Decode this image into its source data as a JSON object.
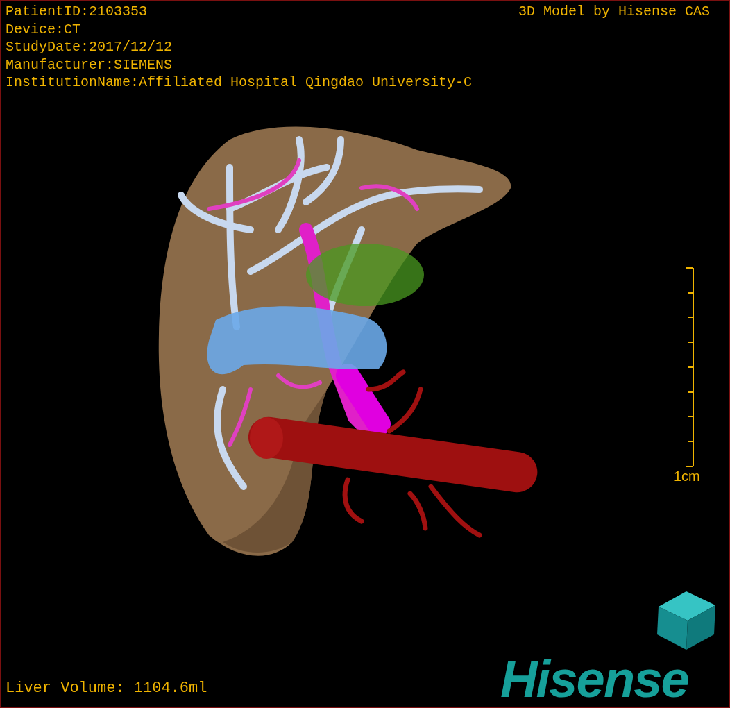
{
  "header_lines": [
    "PatientID:2103353",
    "Device:CT",
    "StudyDate:2017/12/12",
    "Manufacturer:SIEMENS",
    "InstitutionName:Affiliated Hospital Qingdao University-C"
  ],
  "title_right": "3D Model by Hisense CAS",
  "scale_bar": {
    "label": "1cm"
  },
  "footer": "Liver Volume: 1104.6ml",
  "logo": {
    "text": "Hisense"
  }
}
